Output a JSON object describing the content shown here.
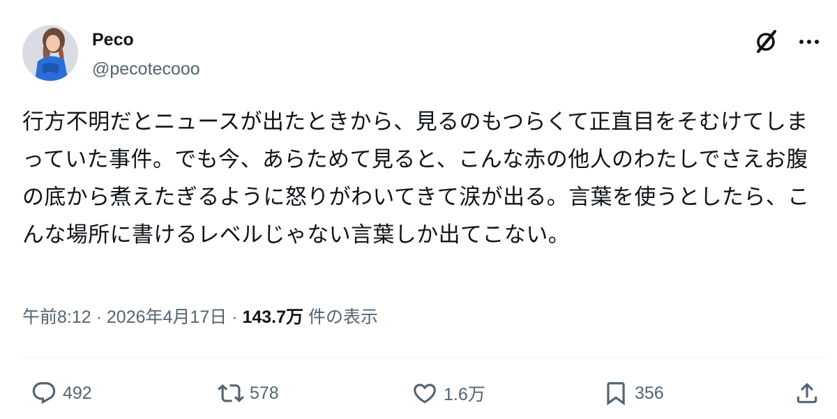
{
  "author": {
    "name": "Peco",
    "handle": "@pecotecooo"
  },
  "tweet": {
    "text": "行方不明だとニュースが出たときから、見るのもつらくて正直目をそむけてしまっていた事件。でも今、あらためて見ると、こんな赤の他人のわたしでさえお腹の底から煮えたぎるように怒りがわいてきて涙が出る。言葉を使うとしたら、こんな場所に書けるレベルじゃない言葉しか出てこない。"
  },
  "meta": {
    "time": "午前8:12",
    "separator": "·",
    "date": "2026年4月17日",
    "views_count": "143.7万",
    "views_label": "件の表示"
  },
  "actions": {
    "replies": "492",
    "reposts": "578",
    "likes": "1.6万",
    "bookmarks": "356"
  },
  "icons": [
    "grok-icon",
    "more-icon",
    "reply-icon",
    "repost-icon",
    "like-icon",
    "bookmark-icon",
    "share-icon"
  ],
  "colors": {
    "text": "#0f1419",
    "secondary": "#536471",
    "avatar_outfit": "#2a6fd6"
  }
}
